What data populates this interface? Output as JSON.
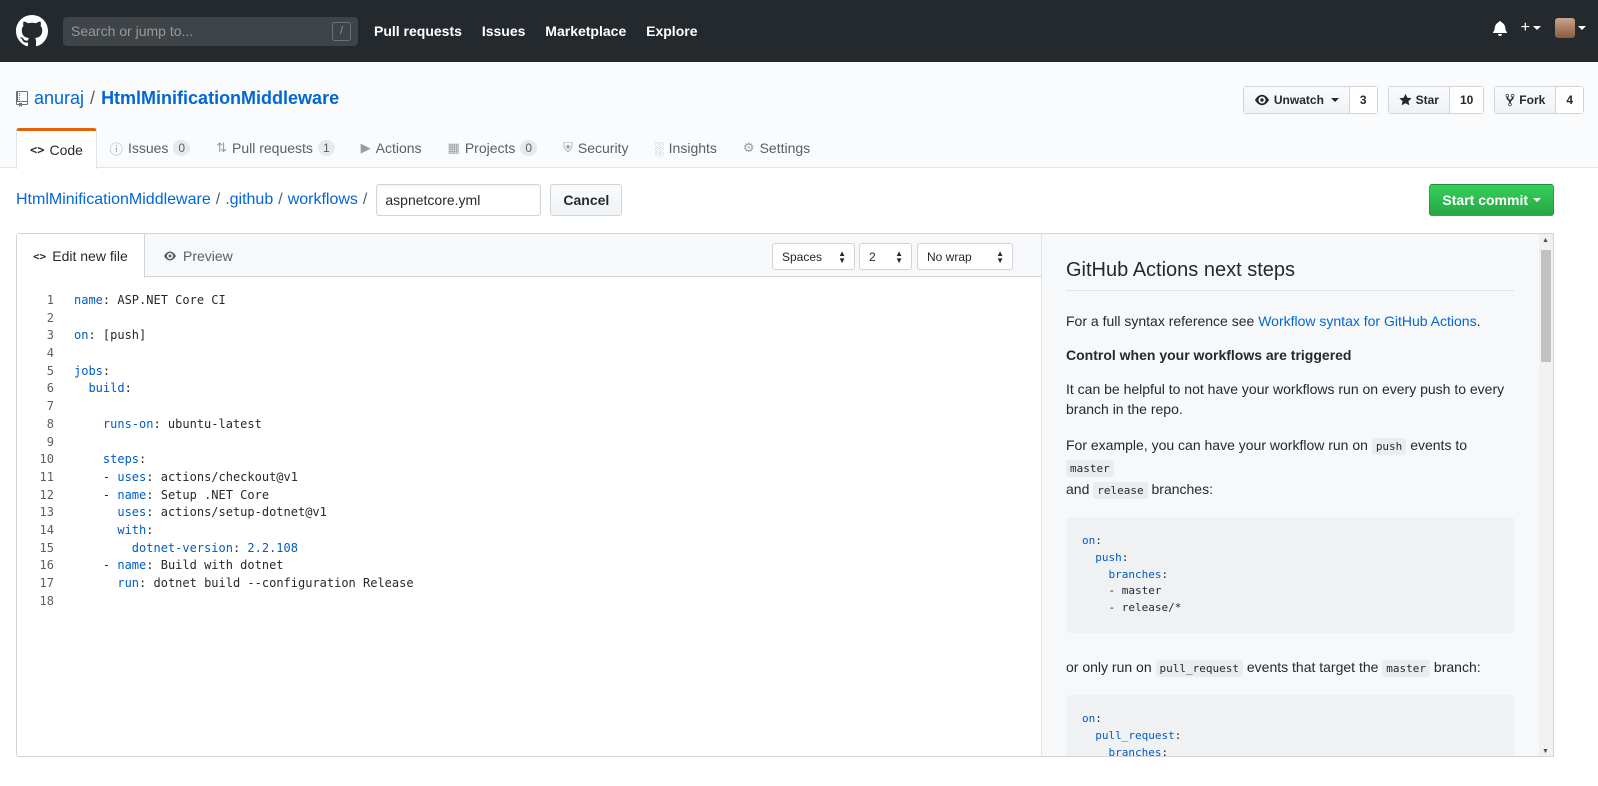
{
  "header": {
    "search_placeholder": "Search or jump to...",
    "search_shortcut": "/",
    "nav": [
      "Pull requests",
      "Issues",
      "Marketplace",
      "Explore"
    ]
  },
  "repo": {
    "owner": "anuraj",
    "separator": "/",
    "name": "HtmlMinificationMiddleware",
    "watch_label": "Unwatch",
    "watch_count": "3",
    "star_label": "Star",
    "star_count": "10",
    "fork_label": "Fork",
    "fork_count": "4"
  },
  "tabs": [
    {
      "label": "Code",
      "icon": "code-icon"
    },
    {
      "label": "Issues",
      "count": "0",
      "icon": "issue-icon"
    },
    {
      "label": "Pull requests",
      "count": "1",
      "icon": "pull-request-icon"
    },
    {
      "label": "Actions",
      "icon": "play-icon"
    },
    {
      "label": "Projects",
      "count": "0",
      "icon": "project-icon"
    },
    {
      "label": "Security",
      "icon": "shield-icon"
    },
    {
      "label": "Insights",
      "icon": "graph-icon"
    },
    {
      "label": "Settings",
      "icon": "gear-icon"
    }
  ],
  "breadcrumb": {
    "root": "HtmlMinificationMiddleware",
    "dir1": ".github",
    "dir2": "workflows",
    "sep": "/",
    "filename": "aspnetcore.yml",
    "cancel": "Cancel"
  },
  "commit_button": "Start commit",
  "editor": {
    "tab_edit": "Edit new file",
    "tab_preview": "Preview",
    "indent_mode": "Spaces",
    "indent_size": "2",
    "wrap_mode": "No wrap",
    "lines": [
      {
        "n": "1",
        "k": "name",
        "v": ": ASP.NET Core CI",
        "ind": ""
      },
      {
        "n": "2",
        "k": "",
        "v": "",
        "ind": ""
      },
      {
        "n": "3",
        "k": "on",
        "v": ": [push]",
        "ind": ""
      },
      {
        "n": "4",
        "k": "",
        "v": "",
        "ind": ""
      },
      {
        "n": "5",
        "k": "jobs",
        "v": ":",
        "ind": ""
      },
      {
        "n": "6",
        "k": "build",
        "v": ":",
        "ind": "  "
      },
      {
        "n": "7",
        "k": "",
        "v": "",
        "ind": ""
      },
      {
        "n": "8",
        "k": "runs-on",
        "v": ": ubuntu-latest",
        "ind": "    "
      },
      {
        "n": "9",
        "k": "",
        "v": "",
        "ind": ""
      },
      {
        "n": "10",
        "k": "steps",
        "v": ":",
        "ind": "    "
      },
      {
        "n": "11",
        "k": "uses",
        "v": ": actions/checkout@v1",
        "ind": "    - "
      },
      {
        "n": "12",
        "k": "name",
        "v": ": Setup .NET Core",
        "ind": "    - "
      },
      {
        "n": "13",
        "k": "uses",
        "v": ": actions/setup-dotnet@v1",
        "ind": "      "
      },
      {
        "n": "14",
        "k": "with",
        "v": ":",
        "ind": "      "
      },
      {
        "n": "15",
        "k": "dotnet-version",
        "v": ": ",
        "num": "2.2.108",
        "ind": "        "
      },
      {
        "n": "16",
        "k": "name",
        "v": ": Build with dotnet",
        "ind": "    - "
      },
      {
        "n": "17",
        "k": "run",
        "v": ": dotnet build --configuration Release",
        "ind": "      "
      },
      {
        "n": "18",
        "k": "",
        "v": "",
        "ind": ""
      }
    ]
  },
  "side": {
    "title": "GitHub Actions next steps",
    "p1_text": "For a full syntax reference see ",
    "p1_link": "Workflow syntax for GitHub Actions",
    "p1_end": ".",
    "h3": "Control when your workflows are triggered",
    "p2": "It can be helpful to not have your workflows run on every push to every branch in the repo.",
    "p3_a": "For example, you can have your workflow run on ",
    "p3_code1": "push",
    "p3_b": " events to ",
    "p3_code2": "master",
    "p3_c": "and ",
    "p3_code3": "release",
    "p3_d": " branches:",
    "pre1": "on:\n  push:\n    branches:\n    - master\n    - release/*",
    "p4_a": "or only run on ",
    "p4_code1": "pull_request",
    "p4_b": " events that target the ",
    "p4_code2": "master",
    "p4_c": " branch:",
    "pre2": "on:\n  pull_request:\n    branches:\n    - master"
  }
}
